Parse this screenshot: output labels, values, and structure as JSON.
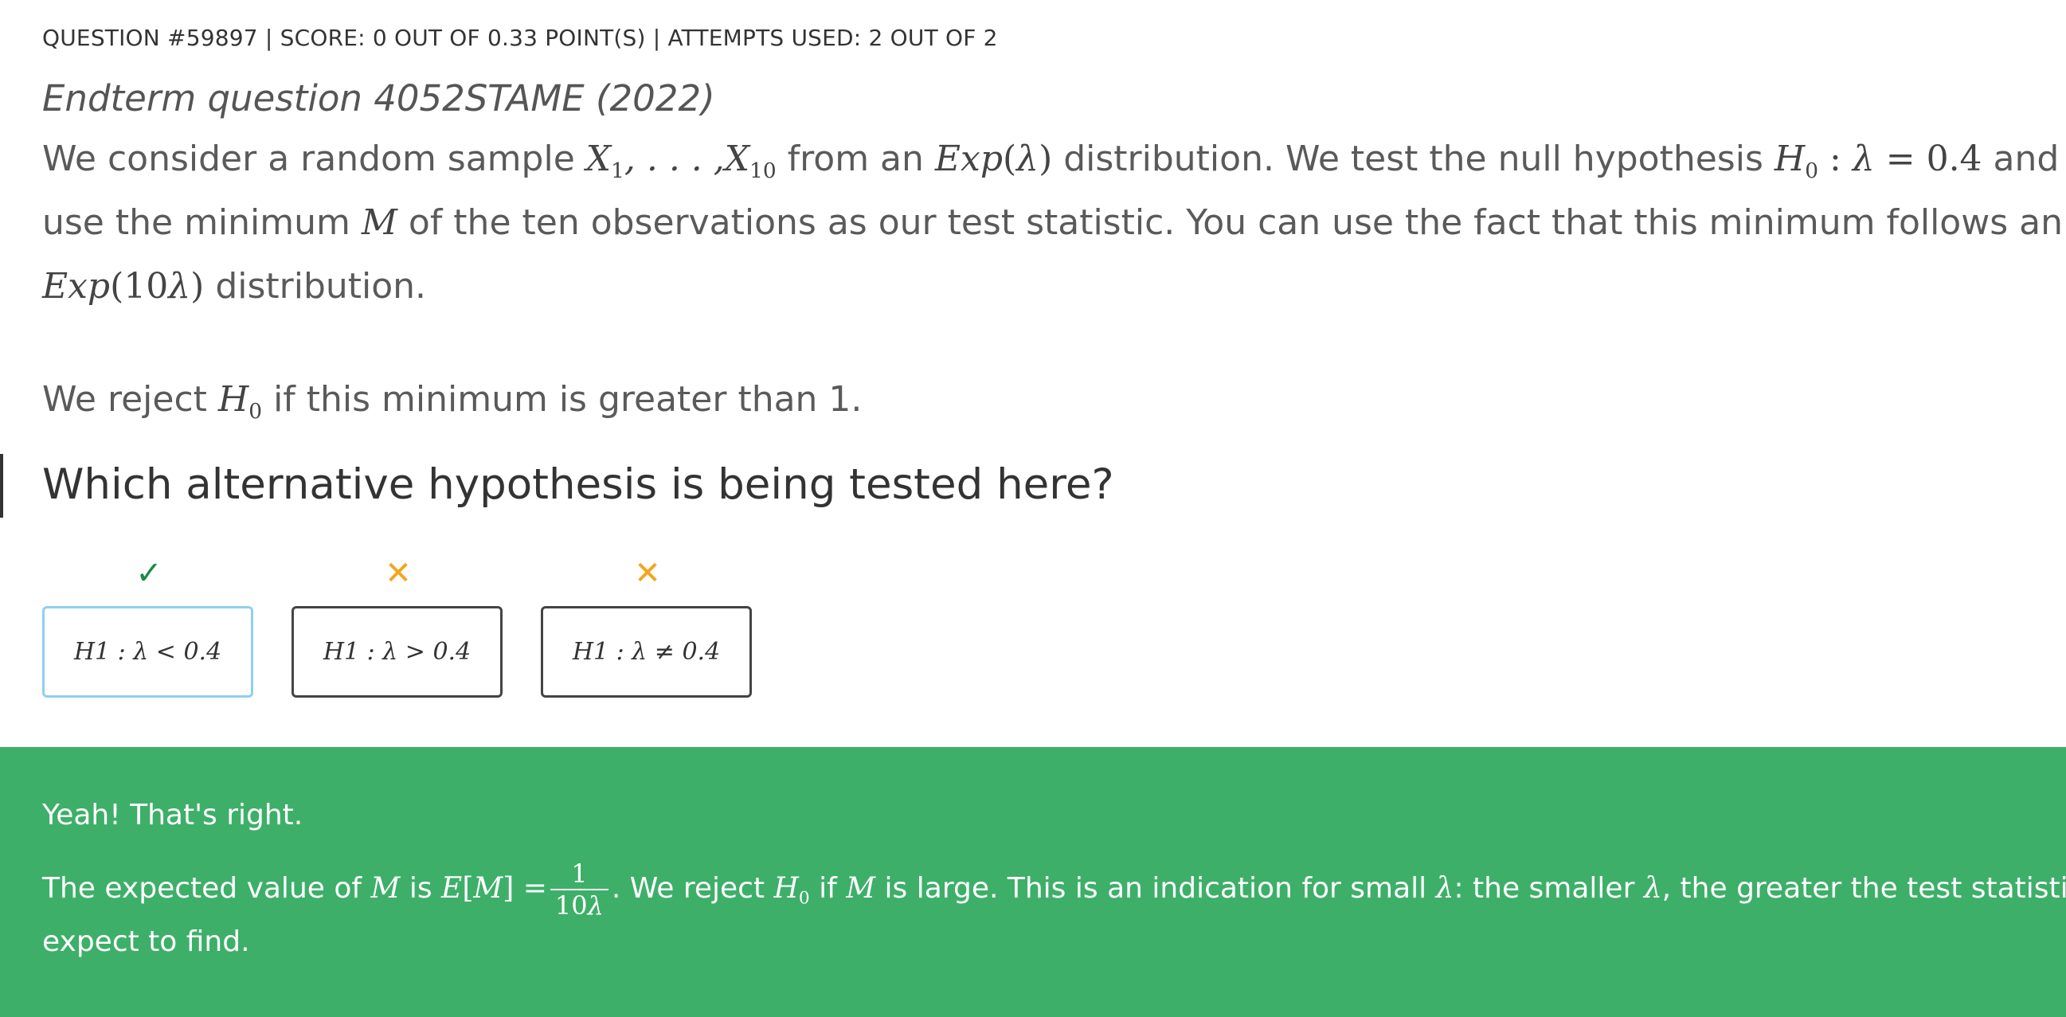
{
  "header": {
    "text": "QUESTION #59897 | SCORE: 0 OUT OF 0.33 POINT(S) |  ATTEMPTS USED: 2 OUT OF 2"
  },
  "title": "Endterm question 4052STAME (2022)",
  "body": {
    "line1_a": "We consider a random sample ",
    "line1_b": " from an ",
    "line1_c": " distribution. We test the null hypothesis ",
    "line1_d": " and we",
    "line2_a": "use the minimum ",
    "line2_b": " of the ten observations as our test statistic. You can use the fact that this minimum follows an",
    "line3_b": " distribution.",
    "reject_a": "We reject ",
    "reject_b": " if this minimum is greater than 1."
  },
  "question": "Which alternative hypothesis is being tested here?",
  "options": [
    {
      "label": "H1 : λ < 0.4",
      "status": "correct",
      "mark": "✓",
      "selected": true
    },
    {
      "label": "H1 : λ > 0.4",
      "status": "wrong",
      "mark": "✕",
      "selected": false
    },
    {
      "label": "H1 : λ ≠ 0.4",
      "status": "wrong",
      "mark": "✕",
      "selected": false
    }
  ],
  "feedback": {
    "title": "Yeah! That's right.",
    "line1_a": "The expected value of ",
    "line1_b": " is ",
    "line1_c": ". We reject ",
    "line1_d": " if ",
    "line1_e": " is large. This is an indication for small ",
    "line1_f": ": the smaller ",
    "line1_g": ", the greater the test statistic we",
    "line2": "expect to find."
  },
  "colors": {
    "feedback_bg": "#3daf69",
    "correct_mark": "#1c8a4a",
    "wrong_mark": "#f4a51c",
    "selected_border": "#8fd0f0"
  }
}
